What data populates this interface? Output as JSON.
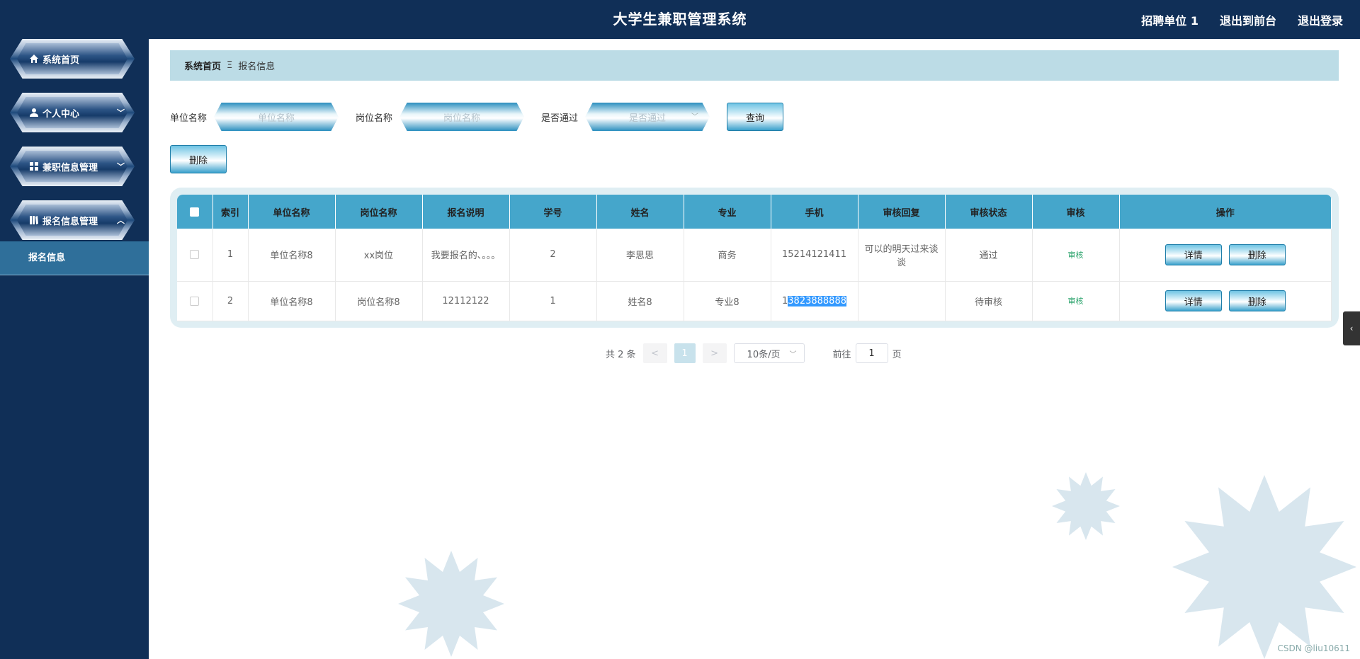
{
  "header": {
    "title": "大学生兼职管理系统",
    "user": "招聘单位 1",
    "to_front": "退出到前台",
    "logout": "退出登录"
  },
  "sidebar": {
    "items": [
      {
        "label": "系统首页",
        "icon": "home-icon"
      },
      {
        "label": "个人中心",
        "icon": "user-icon",
        "chevron": "﹀"
      },
      {
        "label": "兼职信息管理",
        "icon": "grid-icon",
        "chevron": "﹀"
      },
      {
        "label": "报名信息管理",
        "icon": "book-icon",
        "chevron": "︿"
      }
    ],
    "submenu": "报名信息"
  },
  "breadcrumb": {
    "home": "系统首页",
    "sep": "Ξ",
    "current": "报名信息"
  },
  "search": {
    "unit_label": "单位名称",
    "unit_placeholder": "单位名称",
    "job_label": "岗位名称",
    "job_placeholder": "岗位名称",
    "pass_label": "是否通过",
    "pass_placeholder": "是否通过",
    "query": "查询"
  },
  "toolbar": {
    "delete": "删除"
  },
  "table": {
    "headers": [
      "索引",
      "单位名称",
      "岗位名称",
      "报名说明",
      "学号",
      "姓名",
      "专业",
      "手机",
      "审核回复",
      "审核状态",
      "审核",
      "操作"
    ],
    "rows": [
      {
        "index": "1",
        "unit": "单位名称8",
        "job": "xx岗位",
        "desc": "我要报名的、。。。",
        "student_no": "2",
        "name": "李思思",
        "major": "商务",
        "phone": "15214121411",
        "reply": "可以的明天过来谈谈",
        "status": "通过",
        "audit": "审核",
        "detail": "详情",
        "del": "删除"
      },
      {
        "index": "2",
        "unit": "单位名称8",
        "job": "岗位名称8",
        "desc": "12112122",
        "student_no": "1",
        "name": "姓名8",
        "major": "专业8",
        "phone_prefix": "1",
        "phone_selected": "3823888888",
        "reply": "",
        "status": "待审核",
        "audit": "审核",
        "detail": "详情",
        "del": "删除"
      }
    ]
  },
  "pagination": {
    "total": "共 2 条",
    "prev": "<",
    "page": "1",
    "next": ">",
    "size": "10条/页",
    "goto": "前往",
    "goto_value": "1",
    "page_unit": "页"
  },
  "side_tab": "‹",
  "watermark": "CSDN @liu10611"
}
